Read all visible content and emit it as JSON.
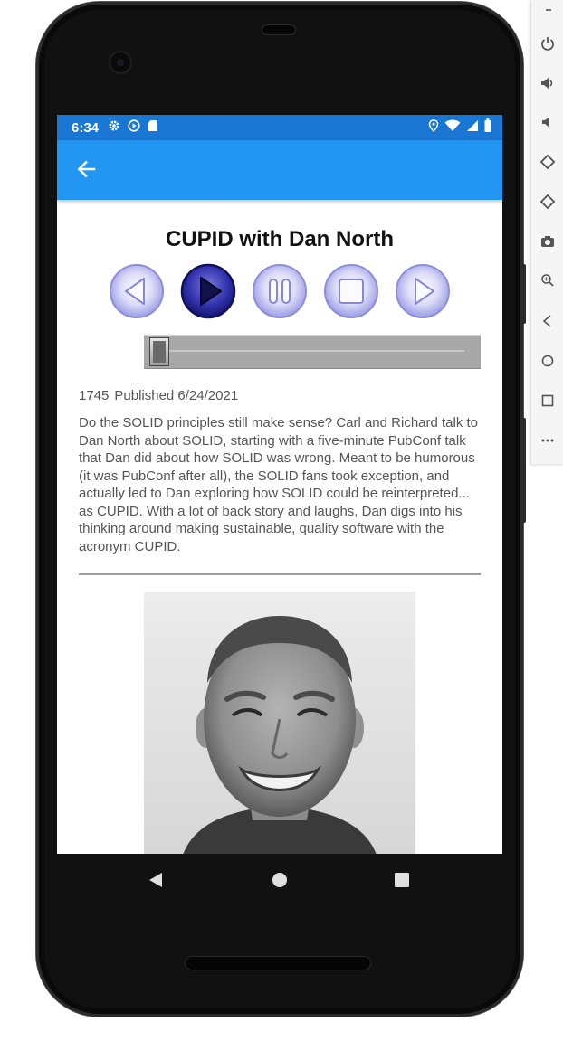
{
  "status_bar": {
    "time": "6:34"
  },
  "app_bar": {
    "back_icon": "arrow-back-icon"
  },
  "episode": {
    "title": "CUPID with Dan North",
    "number": "1745",
    "published": "Published 6/24/2021",
    "description": "Do the SOLID principles still make sense? Carl and Richard talk to Dan North about SOLID, starting with a five-minute PubConf talk that Dan did about how SOLID was wrong. Meant to be humorous (it was PubConf after all), the SOLID fans took exception, and actually led to Dan exploring how SOLID could be reinterpreted... as CUPID. With a lot of back story and laughs, Dan digs into his thinking around making sustainable, quality software with the acronym CUPID."
  },
  "player": {
    "controls": [
      "rewind-icon",
      "play-icon",
      "pause-icon",
      "stop-icon",
      "fast-forward-icon"
    ],
    "active_control": "play-icon",
    "progress": 0.0
  },
  "colors": {
    "status_bar": "#1976d2",
    "app_bar": "#2196f3",
    "button_active": "#1e1ea0",
    "button_inactive": "#b8b8f0"
  }
}
